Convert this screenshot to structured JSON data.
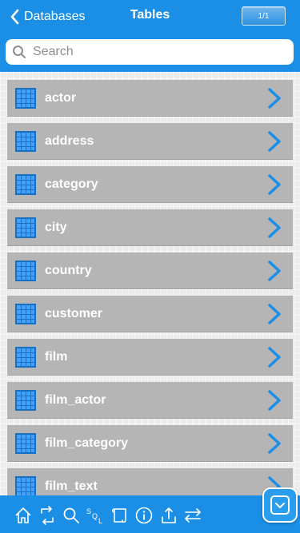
{
  "header": {
    "back_label": "Databases",
    "title": "Tables",
    "page_indicator": "1/1"
  },
  "search": {
    "placeholder": "Search",
    "value": ""
  },
  "tables": [
    {
      "name": "actor"
    },
    {
      "name": "address"
    },
    {
      "name": "category"
    },
    {
      "name": "city"
    },
    {
      "name": "country"
    },
    {
      "name": "customer"
    },
    {
      "name": "film"
    },
    {
      "name": "film_actor"
    },
    {
      "name": "film_category"
    },
    {
      "name": "film_text"
    }
  ],
  "toolbar": {
    "items": [
      "home-icon",
      "sync-icon",
      "search-icon",
      "sql-icon",
      "scroll-icon",
      "info-icon",
      "upload-icon",
      "transfer-icon"
    ],
    "sql_text": "SQL"
  },
  "colors": {
    "accent": "#1b8fe6",
    "row_background": "#b5b5b5",
    "list_background": "#ececec"
  }
}
